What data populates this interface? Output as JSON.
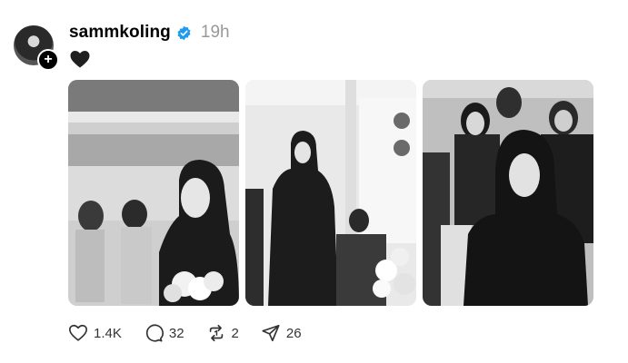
{
  "post": {
    "username": "sammkoling",
    "time": "19h",
    "caption_icon": "heart-icon"
  },
  "images": [
    {
      "name": "photo-1"
    },
    {
      "name": "photo-2"
    },
    {
      "name": "photo-3"
    }
  ],
  "actions": {
    "like_count": "1.4K",
    "reply_count": "32",
    "repost_count": "2",
    "share_count": "26"
  },
  "colors": {
    "verified": "#1d9bf0",
    "muted": "#999999"
  }
}
